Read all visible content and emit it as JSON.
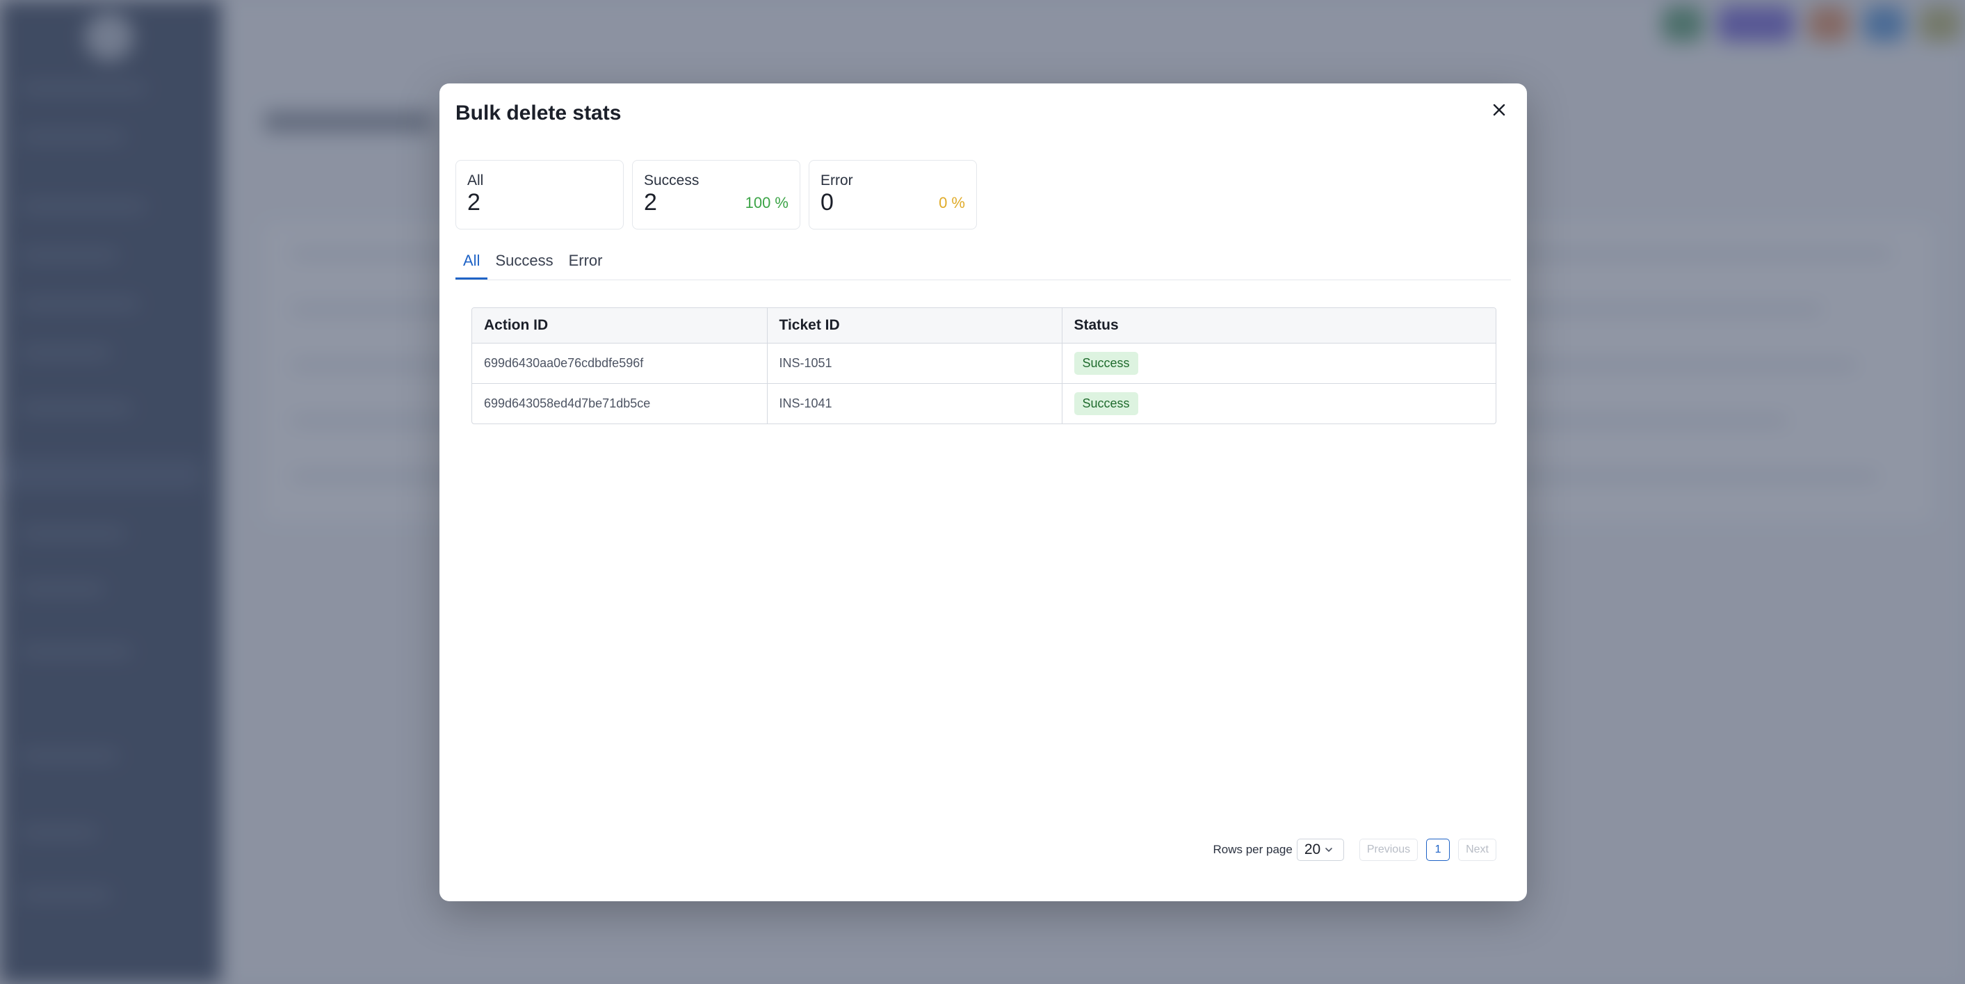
{
  "modal": {
    "title": "Bulk delete stats"
  },
  "stats": {
    "all": {
      "label": "All",
      "value": "2"
    },
    "success": {
      "label": "Success",
      "value": "2",
      "percent": "100 %"
    },
    "error": {
      "label": "Error",
      "value": "0",
      "percent": "0 %"
    }
  },
  "tabs": [
    {
      "label": "All",
      "active": true
    },
    {
      "label": "Success",
      "active": false
    },
    {
      "label": "Error",
      "active": false
    }
  ],
  "table": {
    "columns": [
      "Action ID",
      "Ticket ID",
      "Status"
    ],
    "rows": [
      {
        "action_id": "699d6430aa0e76cdbdfe596f",
        "ticket_id": "INS-1051",
        "status": "Success"
      },
      {
        "action_id": "699d643058ed4d7be71db5ce",
        "ticket_id": "INS-1041",
        "status": "Success"
      }
    ]
  },
  "pagination": {
    "rows_per_page_label": "Rows per page",
    "rows_per_page_value": "20",
    "previous_label": "Previous",
    "next_label": "Next",
    "current_page": "1"
  },
  "colors": {
    "accent": "#1f63c6",
    "success_text": "#3ca447",
    "warning_text": "#e0ab29",
    "badge_bg": "#ddf3e0"
  }
}
